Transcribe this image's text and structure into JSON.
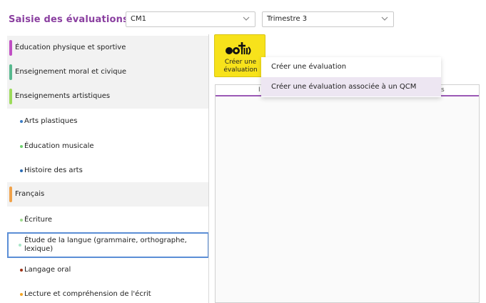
{
  "header": {
    "title": "Saisie des évaluations",
    "class_select": {
      "value": "CM1"
    },
    "term_select": {
      "value": "Trimestre 3"
    }
  },
  "subjects": [
    {
      "label": "Éducation physique et sportive",
      "color": "#c04fc4",
      "level": 0
    },
    {
      "label": "Enseignement moral et civique",
      "color": "#58b98f",
      "level": 0
    },
    {
      "label": "Enseignements artistiques",
      "color": "#9ddb5b",
      "level": 0
    },
    {
      "label": "Arts plastiques",
      "color": "#3d7ec6",
      "level": 1
    },
    {
      "label": "Éducation musicale",
      "color": "#6dd26d",
      "level": 1
    },
    {
      "label": "Histoire des arts",
      "color": "#2a6cb5",
      "level": 1
    },
    {
      "label": "Français",
      "color": "#f0a24a",
      "level": 0
    },
    {
      "label": "Écriture",
      "color": "#9ddb8c",
      "level": 1
    },
    {
      "label": "Étude de la langue (grammaire, orthographe, lexique)",
      "color": "#a8e6c8",
      "level": 1
    },
    {
      "label": "Langage oral",
      "color": "#a03216",
      "level": 1
    },
    {
      "label": "Lecture et compréhension de l'écrit",
      "color": "#f5a623",
      "level": 1
    }
  ],
  "toolbar": {
    "create_label_line1": "Créer une",
    "create_label_line2": "évaluation"
  },
  "table": {
    "header_partial": "I",
    "header_right_partial": "s"
  },
  "context_menu": {
    "items": [
      {
        "label": "Créer une évaluation"
      },
      {
        "label": "Créer une évaluation associée à un QCM"
      }
    ]
  }
}
